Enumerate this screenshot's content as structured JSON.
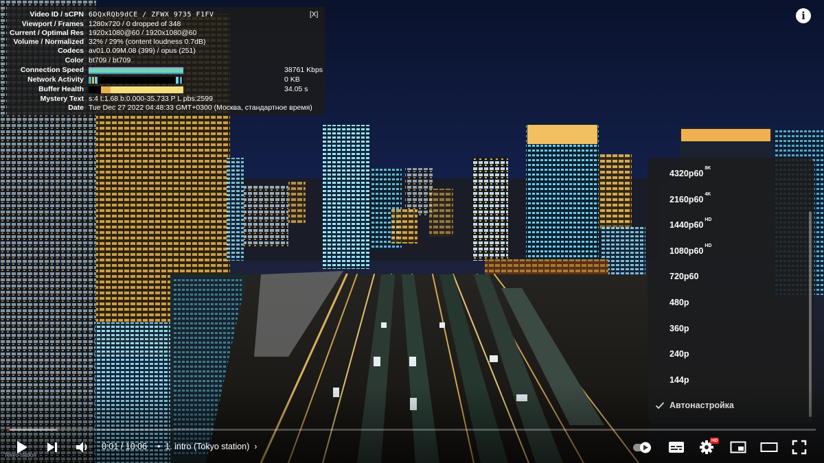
{
  "stats": {
    "close": "[X]",
    "rows": [
      {
        "label": "Video ID / sCPN",
        "value": "6DQxRQb9dCE / ZFWX 9735 F1FV"
      },
      {
        "label": "Viewport / Frames",
        "value": "1280x720 / 0 dropped of 348"
      },
      {
        "label": "Current / Optimal Res",
        "value": "1920x1080@60 / 1920x1080@60"
      },
      {
        "label": "Volume / Normalized",
        "value": "32% / 29% (content loudness 0.7dB)"
      },
      {
        "label": "Codecs",
        "value": "av01.0.09M.08 (399) / opus (251)"
      },
      {
        "label": "Color",
        "value": "bt709 / bt709"
      },
      {
        "label": "Connection Speed",
        "value": "38761 Kbps"
      },
      {
        "label": "Network Activity",
        "value": "0 KB"
      },
      {
        "label": "Buffer Health",
        "value": "34.05 s"
      },
      {
        "label": "Mystery Text",
        "value": "s:4 t:1.68 b:0.000-35.733 P L pbs:2599"
      },
      {
        "label": "Date",
        "value": "Tue Dec 27 2022 04:48:33 GMT+0300 (Москва, стандартное время)"
      }
    ]
  },
  "info_button": "i",
  "quality_menu": {
    "items": [
      {
        "label": "4320p60",
        "badge": "8K",
        "selected": false
      },
      {
        "label": "2160p60",
        "badge": "4K",
        "selected": false
      },
      {
        "label": "1440p60",
        "badge": "HD",
        "selected": false
      },
      {
        "label": "1080p60",
        "badge": "HD",
        "selected": false
      },
      {
        "label": "720p60",
        "badge": "",
        "selected": false
      },
      {
        "label": "480p",
        "badge": "",
        "selected": false
      },
      {
        "label": "360p",
        "badge": "",
        "selected": false
      },
      {
        "label": "240p",
        "badge": "",
        "selected": false
      },
      {
        "label": "144p",
        "badge": "",
        "selected": false
      },
      {
        "label": "Автонастройка",
        "badge": "",
        "selected": true
      }
    ]
  },
  "controls": {
    "time": "0:01 / 10:06",
    "chapter": "1. intro (Tokyo station)",
    "progress_played_fraction": 0.002,
    "progress_loaded_fraction": 0.06,
    "settings_badge": "HD",
    "accent_color": "#ff0000"
  },
  "watermark": "Tokyo station"
}
